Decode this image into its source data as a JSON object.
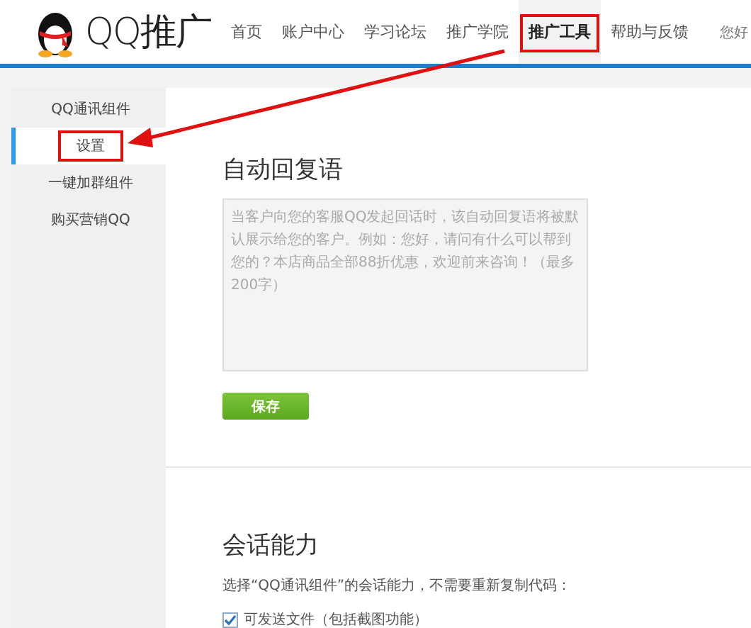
{
  "header": {
    "logo_text": "QQ推广",
    "nav": [
      {
        "label": "首页",
        "selected": false,
        "highlighted": false
      },
      {
        "label": "账户中心",
        "selected": false,
        "highlighted": false
      },
      {
        "label": "学习论坛",
        "selected": false,
        "highlighted": false
      },
      {
        "label": "推广学院",
        "selected": false,
        "highlighted": false
      },
      {
        "label": "推广工具",
        "selected": true,
        "highlighted": true
      },
      {
        "label": "帮助与反馈",
        "selected": false,
        "highlighted": false
      }
    ],
    "greeting": "您好"
  },
  "sidebar": {
    "items": [
      {
        "label": "QQ通讯组件",
        "selected": false,
        "highlighted": false
      },
      {
        "label": "设置",
        "selected": true,
        "highlighted": true
      },
      {
        "label": "一键加群组件",
        "selected": false,
        "highlighted": false
      },
      {
        "label": "购买营销QQ",
        "selected": false,
        "highlighted": false
      }
    ]
  },
  "auto_reply": {
    "title": "自动回复语",
    "placeholder": "当客户向您的客服QQ发起回话时，该自动回复语将被默认展示给您的客户。例如：您好，请问有什么可以帮到您的？本店商品全部88折优惠，欢迎前来咨询！（最多200字）",
    "save_button": "保存"
  },
  "session": {
    "title": "会话能力",
    "description": "选择“QQ通讯组件”的会话能力，不需要重新复制代码：",
    "options": [
      {
        "label": "可发送文件（包括截图功能）",
        "checked": true
      }
    ]
  }
}
